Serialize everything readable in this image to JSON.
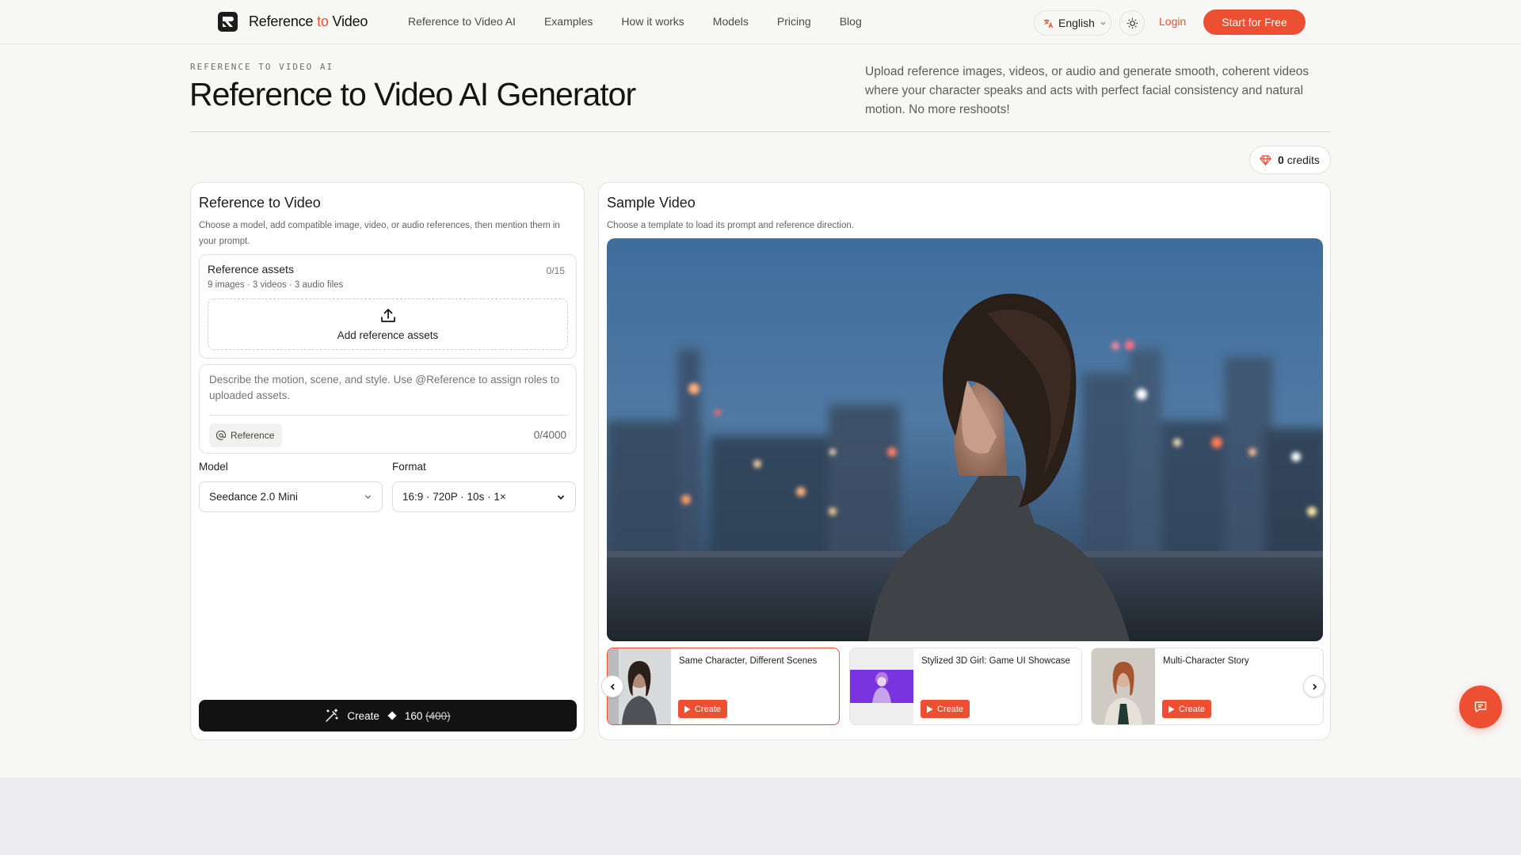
{
  "brand": {
    "name_before": "Reference ",
    "name_accent": "to",
    "name_after": " Video",
    "accent_color": "#ec4f32"
  },
  "nav": {
    "items": [
      {
        "label": "Reference to Video AI"
      },
      {
        "label": "Examples"
      },
      {
        "label": "How it works"
      },
      {
        "label": "Models"
      },
      {
        "label": "Pricing"
      },
      {
        "label": "Blog"
      }
    ],
    "language": "English",
    "login_label": "Login",
    "cta_label": "Start for Free"
  },
  "hero": {
    "eyebrow": "REFERENCE TO VIDEO AI",
    "title": "Reference to Video AI Generator",
    "description": "Upload reference images, videos, or audio and generate smooth, coherent videos where your character speaks and acts with perfect facial consistency and natural motion. No more reshoots!"
  },
  "credits": {
    "amount": "0",
    "label": "credits"
  },
  "generator": {
    "title": "Reference to Video",
    "subtitle": "Choose a model, add compatible image, video, or audio references, then mention them in your prompt.",
    "assets": {
      "title": "Reference assets",
      "count": "0/15",
      "meta": "9 images · 3 videos · 3 audio files",
      "dropzone_label": "Add reference assets"
    },
    "prompt": {
      "placeholder": "Describe the motion, scene, and style. Use @Reference to assign roles to uploaded assets.",
      "reference_button": "Reference",
      "char_count": "0/4000"
    },
    "model": {
      "label": "Model",
      "value": "Seedance 2.0 Mini"
    },
    "format": {
      "label": "Format",
      "value": "16:9 · 720P · 10s · 1×"
    },
    "create": {
      "label": "Create",
      "cost": "160",
      "original_cost": "(400)"
    }
  },
  "sample": {
    "title": "Sample Video",
    "subtitle": "Choose a template to load its prompt and reference direction.",
    "templates": [
      {
        "title": "Same Character, Different Scenes",
        "button": "Create",
        "active": true
      },
      {
        "title": "Stylized 3D Girl: Game UI Showcase",
        "button": "Create",
        "active": false
      },
      {
        "title": "Multi-Character Story",
        "button": "Create",
        "active": false
      }
    ]
  },
  "icons": {
    "logo": "logo-mark-icon",
    "language": "translate-icon",
    "theme": "sun-icon",
    "credits": "gem-icon",
    "upload": "upload-icon",
    "at": "at-icon",
    "wand": "magic-wand-icon",
    "diamond": "diamond-icon",
    "play": "play-icon",
    "chat": "chat-icon"
  }
}
